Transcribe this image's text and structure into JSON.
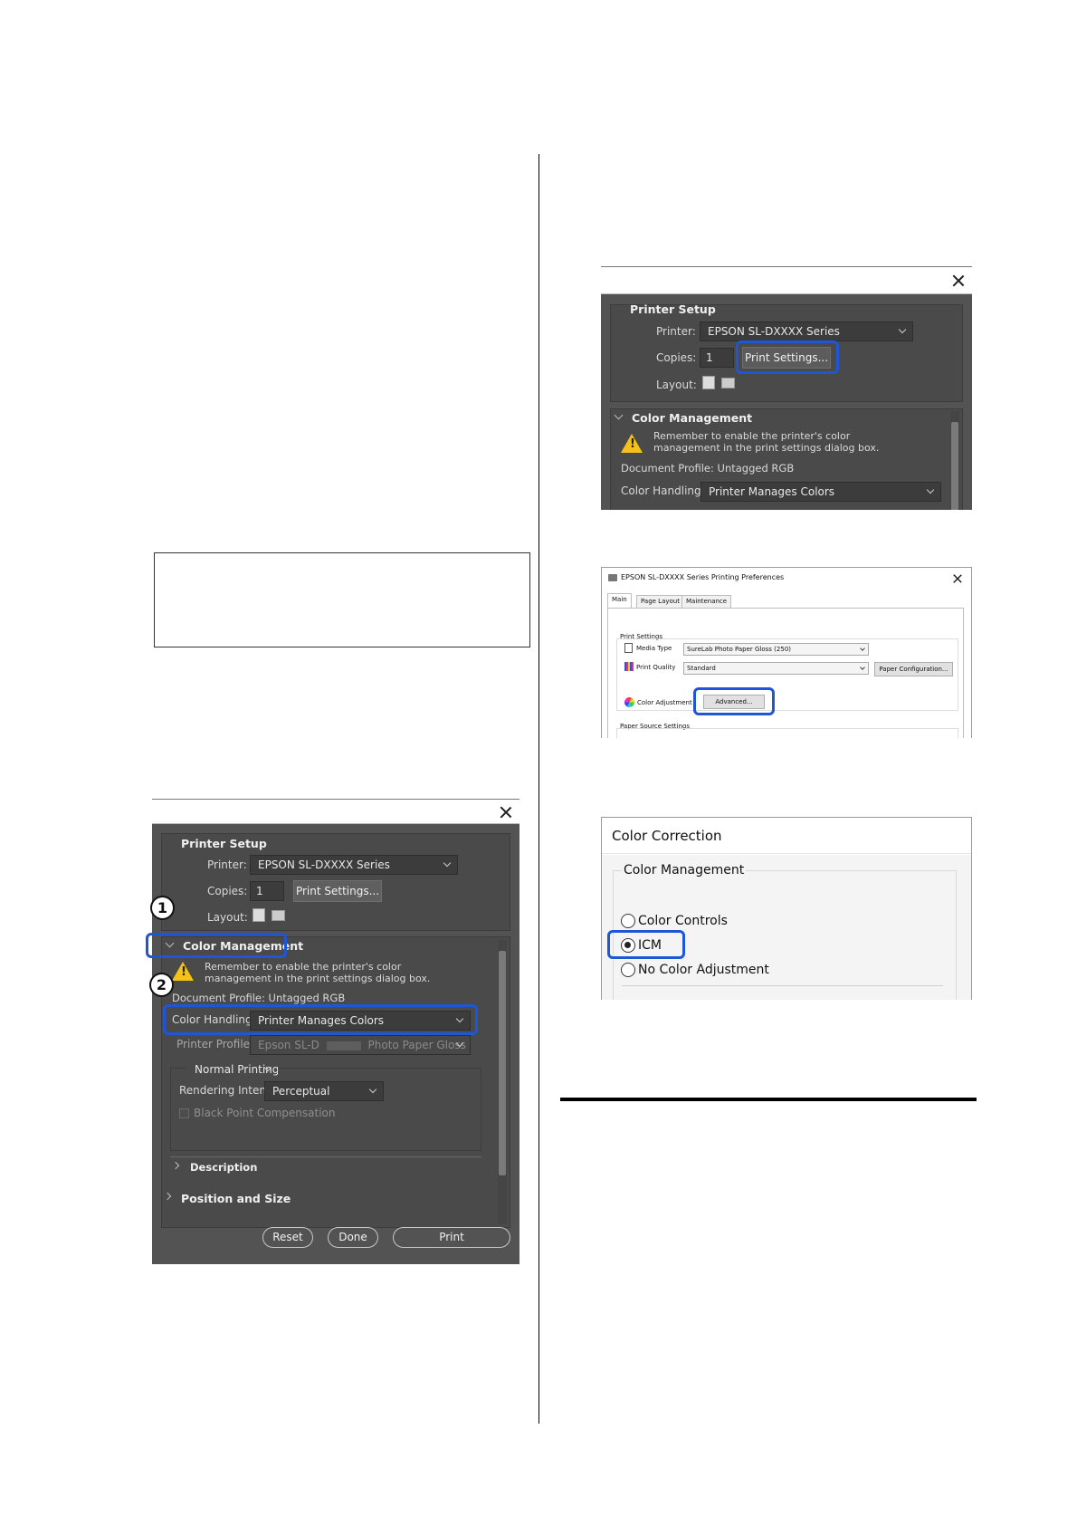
{
  "left_dialog": {
    "section_title": "Printer Setup",
    "printer_label": "Printer:",
    "printer_value": "EPSON SL-DXXXX Series",
    "copies_label": "Copies:",
    "copies_value": "1",
    "print_settings_button": "Print Settings...",
    "layout_label": "Layout:",
    "color_management_title": "Color Management",
    "warning_line1": "Remember to enable the printer's color",
    "warning_line2": "management in the print settings dialog box.",
    "document_profile": "Document Profile: Untagged RGB",
    "color_handling_label": "Color Handling:",
    "color_handling_value": "Printer Manages Colors",
    "printer_profile_label": "Printer Profile:",
    "printer_profile_value_a": "Epson SL-D",
    "printer_profile_value_b": "Photo Paper Gloss",
    "normal_printing": "Normal Printing",
    "rendering_intent_label": "Rendering Intent:",
    "rendering_intent_value": "Perceptual",
    "black_point": "Black Point Compensation",
    "description": "Description",
    "position_size": "Position and Size",
    "reset_button": "Reset",
    "done_button": "Done",
    "print_button": "Print",
    "callout_1": "1",
    "callout_2": "2"
  },
  "right_dialog_1": {
    "section_title": "Printer Setup",
    "printer_label": "Printer:",
    "printer_value": "EPSON SL-DXXXX Series",
    "copies_label": "Copies:",
    "copies_value": "1",
    "print_settings_button": "Print Settings...",
    "layout_label": "Layout:",
    "color_management_title": "Color Management",
    "warning_line1": "Remember to enable the printer's color",
    "warning_line2": "management in the print settings dialog box.",
    "document_profile": "Document Profile: Untagged RGB",
    "color_handling_label": "Color Handling:",
    "color_handling_value": "Printer Manages Colors"
  },
  "prefs_dialog": {
    "title": "EPSON SL-DXXXX Series Printing Preferences",
    "tabs": [
      "Main",
      "Page Layout",
      "Maintenance"
    ],
    "print_settings_group": "Print Settings",
    "media_type_label": "Media Type",
    "media_type_value": "SureLab Photo Paper Gloss (250)",
    "print_quality_label": "Print Quality",
    "print_quality_value": "Standard",
    "paper_config_button": "Paper Configuration...",
    "color_adjustment_label": "Color Adjustment",
    "advanced_button": "Advanced...",
    "paper_source_group": "Paper Source Settings"
  },
  "color_correction": {
    "title": "Color Correction",
    "group_title": "Color Management",
    "options": [
      "Color Controls",
      "ICM",
      "No Color Adjustment"
    ],
    "selected": "ICM"
  },
  "colors": {
    "callout_blue": "#1f56d8",
    "dialog_dark": "#535353",
    "warning_yellow": "#f4c21b"
  }
}
